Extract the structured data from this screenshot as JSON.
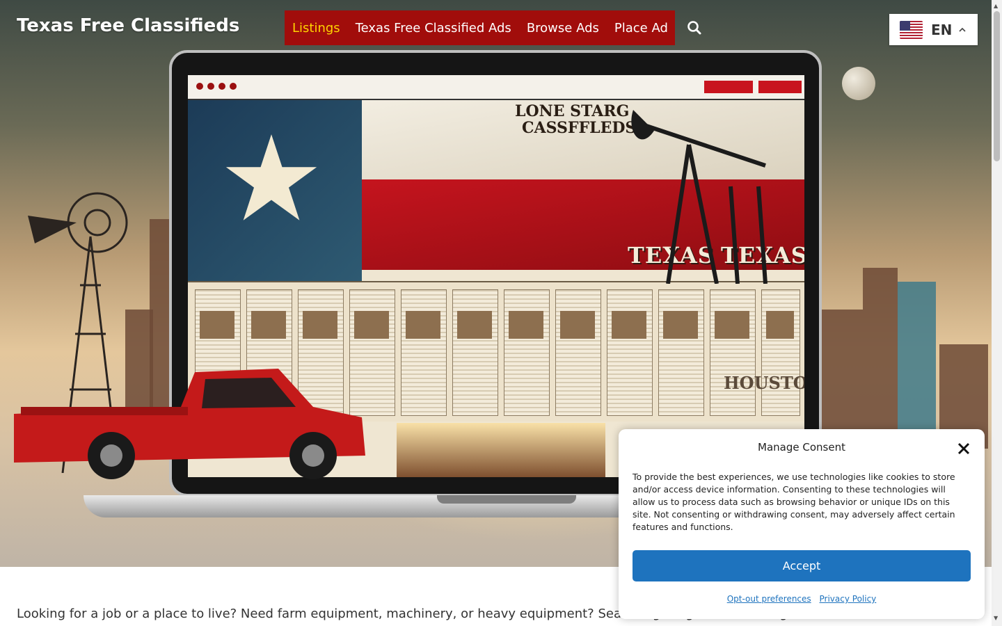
{
  "header": {
    "site_title": "Texas Free Classifieds",
    "nav": [
      {
        "label": "Listings",
        "active": true
      },
      {
        "label": "Texas Free Classified Ads",
        "active": false
      },
      {
        "label": "Browse Ads",
        "active": false
      },
      {
        "label": "Place Ad",
        "active": false
      }
    ],
    "search_icon": "search-icon",
    "language": {
      "code": "EN",
      "flag": "us-flag-icon",
      "chevron": "chevron-up-icon"
    }
  },
  "hero": {
    "image_text": {
      "headline": [
        "LONE STARG",
        "CASSFFLEDS"
      ],
      "texas_left": "TEXAS",
      "texas_right": "TEXAS",
      "city": "HOUSTON"
    }
  },
  "main": {
    "intro": "Looking for a job or a place to live? Need farm equipment, machinery, or heavy equipment? Searching for great deals on general merchandise? Browse"
  },
  "consent": {
    "title": "Manage Consent",
    "message": "To provide the best experiences, we use technologies like cookies to store and/or access device information. Consenting to these technologies will allow us to process data such as browsing behavior or unique IDs on this site. Not consenting or withdrawing consent, may adversely affect certain features and functions.",
    "accept_label": "Accept",
    "optout_label": "Opt-out preferences",
    "privacy_label": "Privacy Policy",
    "close_icon": "close-icon"
  },
  "colors": {
    "nav_bg": "#a10d0b",
    "nav_active": "#ffd400",
    "accept_bg": "#1e73be",
    "link": "#1e73be"
  }
}
